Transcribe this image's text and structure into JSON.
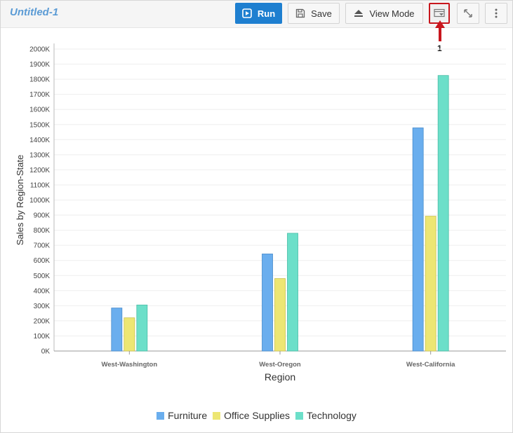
{
  "toolbar": {
    "title": "Untitled-1",
    "run_label": "Run",
    "save_label": "Save",
    "view_mode_label": "View Mode"
  },
  "callout": {
    "number": "1"
  },
  "chart_data": {
    "type": "bar",
    "categories": [
      "West-Washington",
      "West-Oregon",
      "West-California"
    ],
    "series": [
      {
        "name": "Furniture",
        "color": "#6aaeee",
        "values": [
          285000,
          643000,
          1478000
        ]
      },
      {
        "name": "Office Supplies",
        "color": "#ede673",
        "values": [
          220000,
          480000,
          893000
        ]
      },
      {
        "name": "Technology",
        "color": "#6cdfc9",
        "values": [
          305000,
          780000,
          1825000
        ]
      }
    ],
    "xlabel": "Region",
    "ylabel": "Sales by Region-State",
    "ylim": [
      0,
      2000000
    ],
    "yticks": [
      "0K",
      "100K",
      "200K",
      "300K",
      "400K",
      "500K",
      "600K",
      "700K",
      "800K",
      "900K",
      "1000K",
      "1100K",
      "1200K",
      "1300K",
      "1400K",
      "1500K",
      "1600K",
      "1700K",
      "1800K",
      "1900K",
      "2000K"
    ],
    "grid": true,
    "legend_position": "bottom-center"
  }
}
